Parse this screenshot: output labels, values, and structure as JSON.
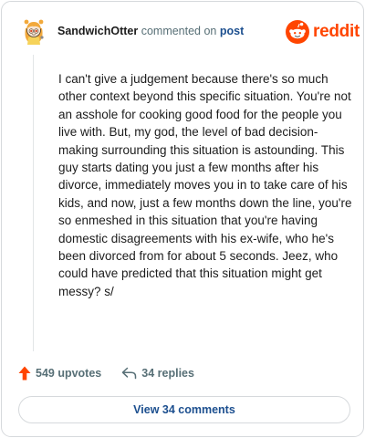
{
  "header": {
    "username": "SandwichOtter",
    "action": "commented on",
    "target": "post",
    "brand": "reddit"
  },
  "comment": {
    "text": "I can't give a judgement because there's so much other context beyond this specific situation. You're not an asshole for cooking good food for the people you live with. But, my god, the level of bad decision-making surrounding this situation is astounding. This guy starts dating you just a few months after his divorce, immediately moves you in to take care of his kids, and now, just a few months down the line, you're so enmeshed in this situation that you're having domestic disagreements with his ex-wife, who he's been divorced from for about 5 seconds. Jeez, who could have predicted that this situation might get messy? s/"
  },
  "footer": {
    "upvotes": "549 upvotes",
    "replies": "34 replies",
    "view_comments": "View 34 comments"
  },
  "icons": {
    "upvote": "upvote-arrow-icon",
    "reply": "reply-arrow-icon",
    "avatar": "snoo-avatar-icon",
    "logo": "reddit-snoo-icon"
  },
  "colors": {
    "brand": "#ff4500",
    "link": "#1c4f8f",
    "muted": "#576f76",
    "border": "#d6d9dc"
  }
}
